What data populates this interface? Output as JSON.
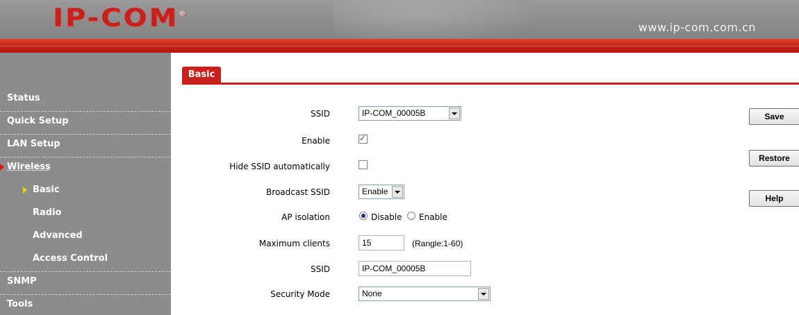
{
  "header": {
    "logo": "IP-COM",
    "logo_mark": "®",
    "url": "www.ip-com.com.cn"
  },
  "sidebar": {
    "items": [
      {
        "label": "Status"
      },
      {
        "label": "Quick Setup"
      },
      {
        "label": "LAN Setup"
      },
      {
        "label": "Wireless"
      },
      {
        "label": "Basic"
      },
      {
        "label": "Radio"
      },
      {
        "label": "Advanced"
      },
      {
        "label": "Access Control"
      },
      {
        "label": "SNMP"
      },
      {
        "label": "Tools"
      }
    ]
  },
  "tab": {
    "label": "Basic"
  },
  "form": {
    "ssid_select": {
      "label": "SSID",
      "value": "IP-COM_00005B"
    },
    "enable": {
      "label": "Enable",
      "checked": true
    },
    "hide_ssid": {
      "label": "Hide SSID automatically",
      "checked": false
    },
    "broadcast_ssid": {
      "label": "Broadcast SSID",
      "value": "Enable"
    },
    "ap_isolation": {
      "label": "AP isolation",
      "option1": "Disable",
      "option2": "Enable",
      "selected": "Disable"
    },
    "max_clients": {
      "label": "Maximum clients",
      "value": "15",
      "hint": "(Rangle:1-60)"
    },
    "ssid_text": {
      "label": "SSID",
      "value": "IP-COM_00005B"
    },
    "security_mode": {
      "label": "Security Mode",
      "value": "None"
    }
  },
  "buttons": {
    "save": "Save",
    "restore": "Restore",
    "help": "Help"
  },
  "colors": {
    "brand_red": "#c8201c",
    "sidebar_gray": "#8c8c8c"
  }
}
